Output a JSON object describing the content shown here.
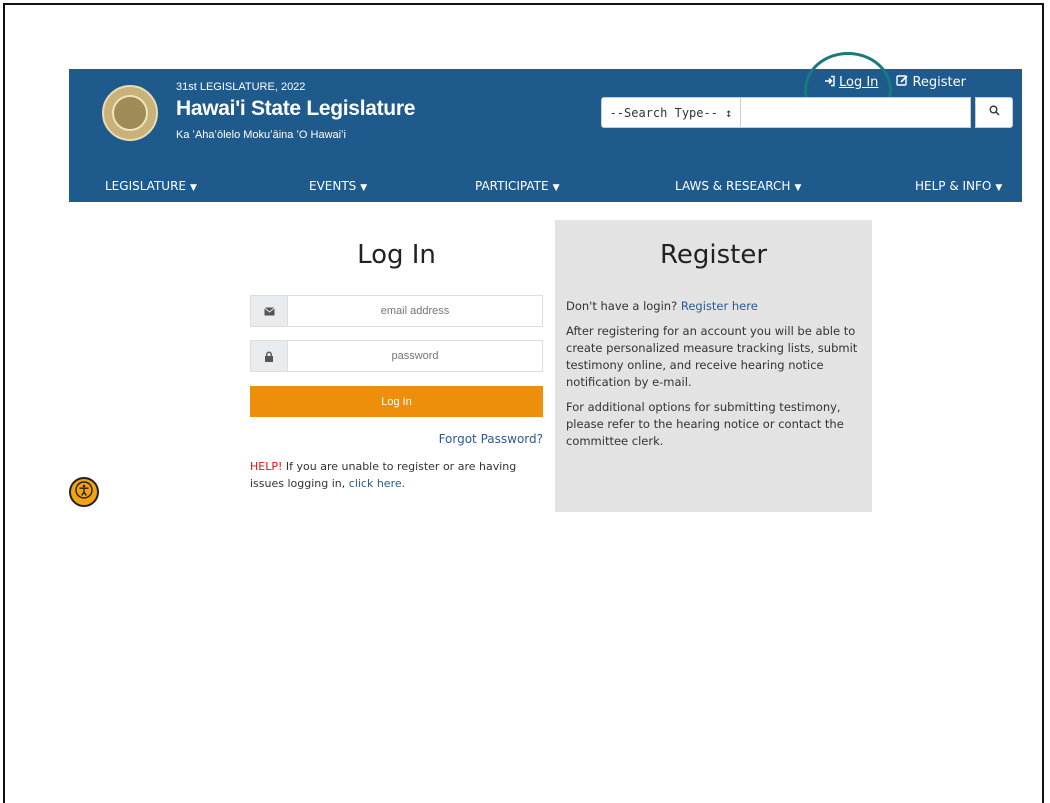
{
  "header": {
    "session": "31st LEGISLATURE, 2022",
    "title": "Hawai'i State Legislature",
    "subtitle": "Ka ʻAhaʻōlelo Mokuʻāina ʻO Hawaiʻi",
    "auth": {
      "login_label": "Log In",
      "register_label": "Register"
    },
    "search": {
      "type_label": "--Search Type-- ↕",
      "placeholder": ""
    },
    "nav": [
      {
        "label": "LEGISLATURE"
      },
      {
        "label": "EVENTS"
      },
      {
        "label": "PARTICIPATE"
      },
      {
        "label": "LAWS & RESEARCH"
      },
      {
        "label": "HELP & INFO"
      }
    ],
    "colors": {
      "bar": "#1e5a8c",
      "highlight": "#167a7e"
    }
  },
  "login": {
    "heading": "Log In",
    "email_placeholder": "email address",
    "password_placeholder": "password",
    "button_label": "Log In",
    "forgot_label": "Forgot Password?",
    "help_tag": "HELP!",
    "help_text": " If you are unable to register or are having issues logging in, ",
    "help_link": "click here",
    "help_end": "."
  },
  "register": {
    "heading": "Register",
    "p1_text": "Don't have a login? ",
    "p1_link": "Register here",
    "p2": "After registering for an account you will be able to create personalized measure tracking lists, submit testimony online, and receive hearing notice notification by e-mail.",
    "p3": "For additional options for submitting testimony, please refer to the hearing notice or contact the committee clerk."
  },
  "icons": {
    "login": "sign-in-icon",
    "register": "edit-icon",
    "search": "search-icon",
    "email": "envelope-icon",
    "password": "lock-icon",
    "accessibility": "accessibility-icon"
  }
}
